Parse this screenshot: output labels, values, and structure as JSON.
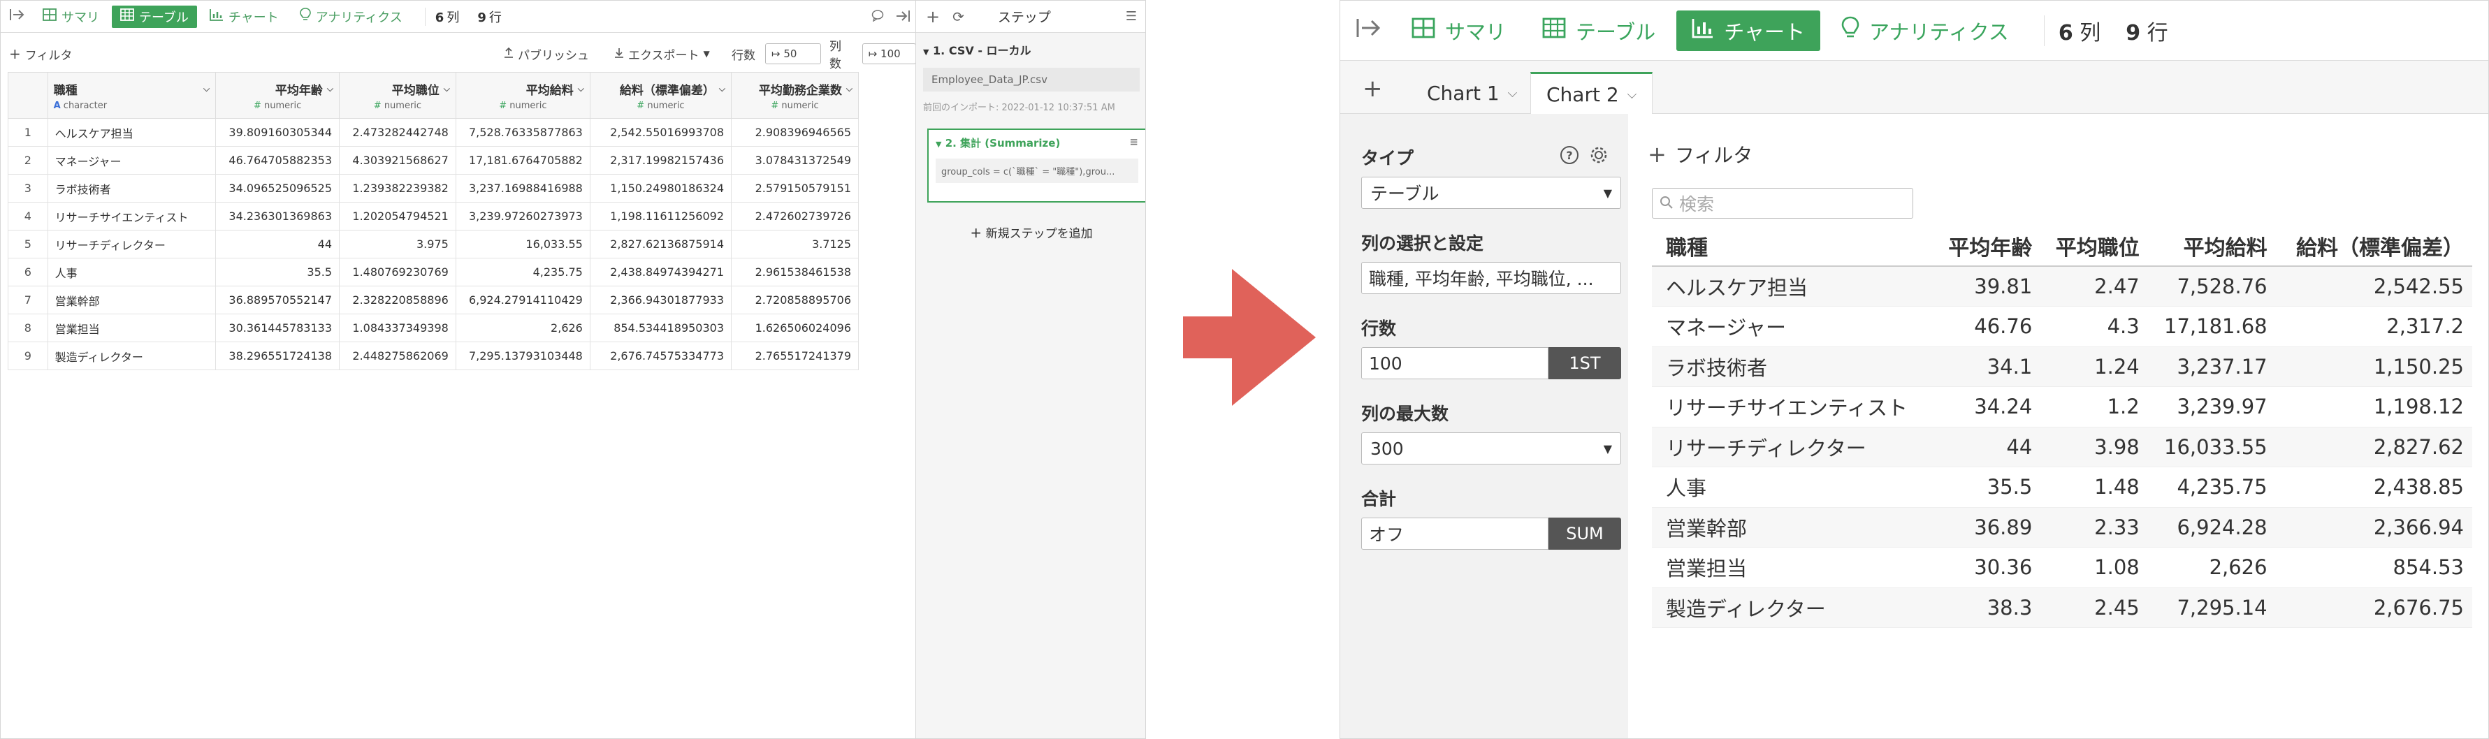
{
  "left": {
    "toolbar": {
      "tabs": [
        {
          "label": "サマリ",
          "icon": "summary-grid-icon",
          "active": false
        },
        {
          "label": "テーブル",
          "icon": "table-icon",
          "active": true
        },
        {
          "label": "チャート",
          "icon": "chart-icon",
          "active": false
        },
        {
          "label": "アナリティクス",
          "icon": "bulb-icon",
          "active": false
        }
      ],
      "cols_count": "6",
      "cols_unit": "列",
      "rows_count": "9",
      "rows_unit": "行"
    },
    "actions": {
      "filter": "フィルタ",
      "publish": "パブリッシュ",
      "export": "エクスポート",
      "rows_label": "行数",
      "rows_value": "50",
      "cols_label": "列数",
      "cols_value": "100"
    },
    "grid": {
      "columns": [
        {
          "name": "職種",
          "type": "character",
          "type_glyph": "A"
        },
        {
          "name": "平均年齢",
          "type": "numeric",
          "type_glyph": "#"
        },
        {
          "name": "平均職位",
          "type": "numeric",
          "type_glyph": "#"
        },
        {
          "name": "平均給料",
          "type": "numeric",
          "type_glyph": "#"
        },
        {
          "name": "給料（標準偏差）",
          "type": "numeric",
          "type_glyph": "#"
        },
        {
          "name": "平均勤務企業数",
          "type": "numeric",
          "type_glyph": "#"
        }
      ],
      "rows": [
        [
          "1",
          "ヘルスケア担当",
          "39.809160305344",
          "2.473282442748",
          "7,528.76335877863",
          "2,542.55016993708",
          "2.908396946565"
        ],
        [
          "2",
          "マネージャー",
          "46.764705882353",
          "4.303921568627",
          "17,181.6764705882",
          "2,317.19982157436",
          "3.078431372549"
        ],
        [
          "3",
          "ラボ技術者",
          "34.096525096525",
          "1.239382239382",
          "3,237.16988416988",
          "1,150.24980186324",
          "2.579150579151"
        ],
        [
          "4",
          "リサーチサイエンティスト",
          "34.236301369863",
          "1.202054794521",
          "3,239.97260273973",
          "1,198.11611256092",
          "2.472602739726"
        ],
        [
          "5",
          "リサーチディレクター",
          "44",
          "3.975",
          "16,033.55",
          "2,827.62136875914",
          "3.7125"
        ],
        [
          "6",
          "人事",
          "35.5",
          "1.480769230769",
          "4,235.75",
          "2,438.84974394271",
          "2.961538461538"
        ],
        [
          "7",
          "営業幹部",
          "36.889570552147",
          "2.328220858896",
          "6,924.27914110429",
          "2,366.94301877933",
          "2.720858895706"
        ],
        [
          "8",
          "営業担当",
          "30.361445783133",
          "1.084337349398",
          "2,626",
          "854.534418950303",
          "1.626506024096"
        ],
        [
          "9",
          "製造ディレクター",
          "38.296551724138",
          "2.448275862069",
          "7,295.13793103448",
          "2,676.74575334773",
          "2.765517241379"
        ]
      ]
    },
    "steps": {
      "title": "ステップ",
      "step1_title": "1. CSV - ローカル",
      "step1_file": "Employee_Data_JP.csv",
      "step1_import": "前回のインポート: 2022-01-12 10:37:51 AM",
      "step2_title": "2. 集計 (Summarize)",
      "step2_code": "group_cols = c(`職種` = \"職種\"),grou...",
      "add_step": "新規ステップを追加"
    }
  },
  "right": {
    "toolbar": {
      "tabs": [
        {
          "label": "サマリ",
          "icon": "summary-grid-icon",
          "active": false
        },
        {
          "label": "テーブル",
          "icon": "table-icon",
          "active": false
        },
        {
          "label": "チャート",
          "icon": "chart-icon",
          "active": true
        },
        {
          "label": "アナリティクス",
          "icon": "bulb-icon",
          "active": false
        }
      ],
      "cols_count": "6",
      "cols_unit": "列",
      "rows_count": "9",
      "rows_unit": "行"
    },
    "chart_tabs": [
      {
        "label": "Chart 1",
        "active": false
      },
      {
        "label": "Chart 2",
        "active": true
      }
    ],
    "settings": {
      "type_label": "タイプ",
      "type_value": "テーブル",
      "columns_label": "列の選択と設定",
      "columns_value": "職種, 平均年齢, 平均職位, ...",
      "rows_label": "行数",
      "rows_value": "100",
      "rows_button": "1ST",
      "maxcols_label": "列の最大数",
      "maxcols_value": "300",
      "total_label": "合計",
      "total_value": "オフ",
      "total_button": "SUM"
    },
    "main": {
      "filter_label": "フィルタ",
      "search_placeholder": "検索",
      "columns": [
        "職種",
        "平均年齢",
        "平均職位",
        "平均給料",
        "給料（標準偏差）"
      ],
      "rows": [
        [
          "ヘルスケア担当",
          "39.81",
          "2.47",
          "7,528.76",
          "2,542.55"
        ],
        [
          "マネージャー",
          "46.76",
          "4.3",
          "17,181.68",
          "2,317.2"
        ],
        [
          "ラボ技術者",
          "34.1",
          "1.24",
          "3,237.17",
          "1,150.25"
        ],
        [
          "リサーチサイエンティスト",
          "34.24",
          "1.2",
          "3,239.97",
          "1,198.12"
        ],
        [
          "リサーチディレクター",
          "44",
          "3.98",
          "16,033.55",
          "2,827.62"
        ],
        [
          "人事",
          "35.5",
          "1.48",
          "4,235.75",
          "2,438.85"
        ],
        [
          "営業幹部",
          "36.89",
          "2.33",
          "6,924.28",
          "2,366.94"
        ],
        [
          "営業担当",
          "30.36",
          "1.08",
          "2,626",
          "854.53"
        ],
        [
          "製造ディレクター",
          "38.3",
          "2.45",
          "7,295.14",
          "2,676.75"
        ]
      ]
    }
  },
  "colors": {
    "accent_green": "#3ea35a",
    "arrow_red": "#e0625a"
  }
}
